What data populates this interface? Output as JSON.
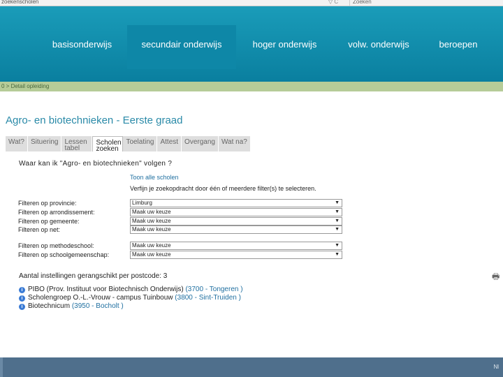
{
  "address_bar": {
    "url": "zoekenscholen",
    "controls": "▽ C",
    "search_placeholder": "Zoeken"
  },
  "nav": {
    "items": [
      {
        "label": "basisonderwijs",
        "active": false
      },
      {
        "label": "secundair onderwijs",
        "active": true
      },
      {
        "label": "hoger onderwijs",
        "active": false
      },
      {
        "label": "volw. onderwijs",
        "active": false
      },
      {
        "label": "beroepen",
        "active": false
      }
    ]
  },
  "breadcrumb": {
    "text": "0 > Detail opleiding"
  },
  "page": {
    "title": "Agro- en biotechnieken - Eerste graad"
  },
  "tabs": [
    {
      "label": "Wat?",
      "active": false
    },
    {
      "label": "Situering",
      "active": false
    },
    {
      "label": "Lessen tabel",
      "active": false
    },
    {
      "label": "Scholen zoeken",
      "active": true
    },
    {
      "label": "Toelating",
      "active": false
    },
    {
      "label": "Attest",
      "active": false
    },
    {
      "label": "Overgang",
      "active": false
    },
    {
      "label": "Wat na?",
      "active": false
    }
  ],
  "search": {
    "question": "Waar kan ik \"Agro- en biotechnieken\" volgen ?",
    "show_all_link": "Toon alle scholen",
    "hint": "Verfijn je zoekopdracht door één of meerdere filter(s) te selecteren."
  },
  "filters": [
    {
      "label": "Filteren op provincie:",
      "value": "Limburg"
    },
    {
      "label": "Filteren op arrondissement:",
      "value": "Maak uw keuze"
    },
    {
      "label": "Filteren op gemeente:",
      "value": "Maak uw keuze"
    },
    {
      "label": "Filteren op net:",
      "value": "Maak uw keuze"
    },
    {
      "label": "Filteren op methodeschool:",
      "value": "Maak uw keuze"
    },
    {
      "label": "Filteren op schoolgemeenschap:",
      "value": "Maak uw keuze"
    }
  ],
  "results": {
    "count_text": "Aantal instellingen gerangschikt per postcode: 3",
    "schools": [
      {
        "name": "PIBO (Prov. Instituut voor Biotechnisch Onderwijs)",
        "location": "(3700 - Tongeren )"
      },
      {
        "name": "Scholengroep O.-L.-Vrouw - campus Tuinbouw",
        "location": "(3800 - Sint-Truiden )"
      },
      {
        "name": "Biotechnicum",
        "location": "(3950 - Bocholt )"
      }
    ]
  },
  "footer": {
    "lang": "Nl"
  },
  "icons": {
    "info": "info-icon",
    "print": "printer-icon"
  }
}
